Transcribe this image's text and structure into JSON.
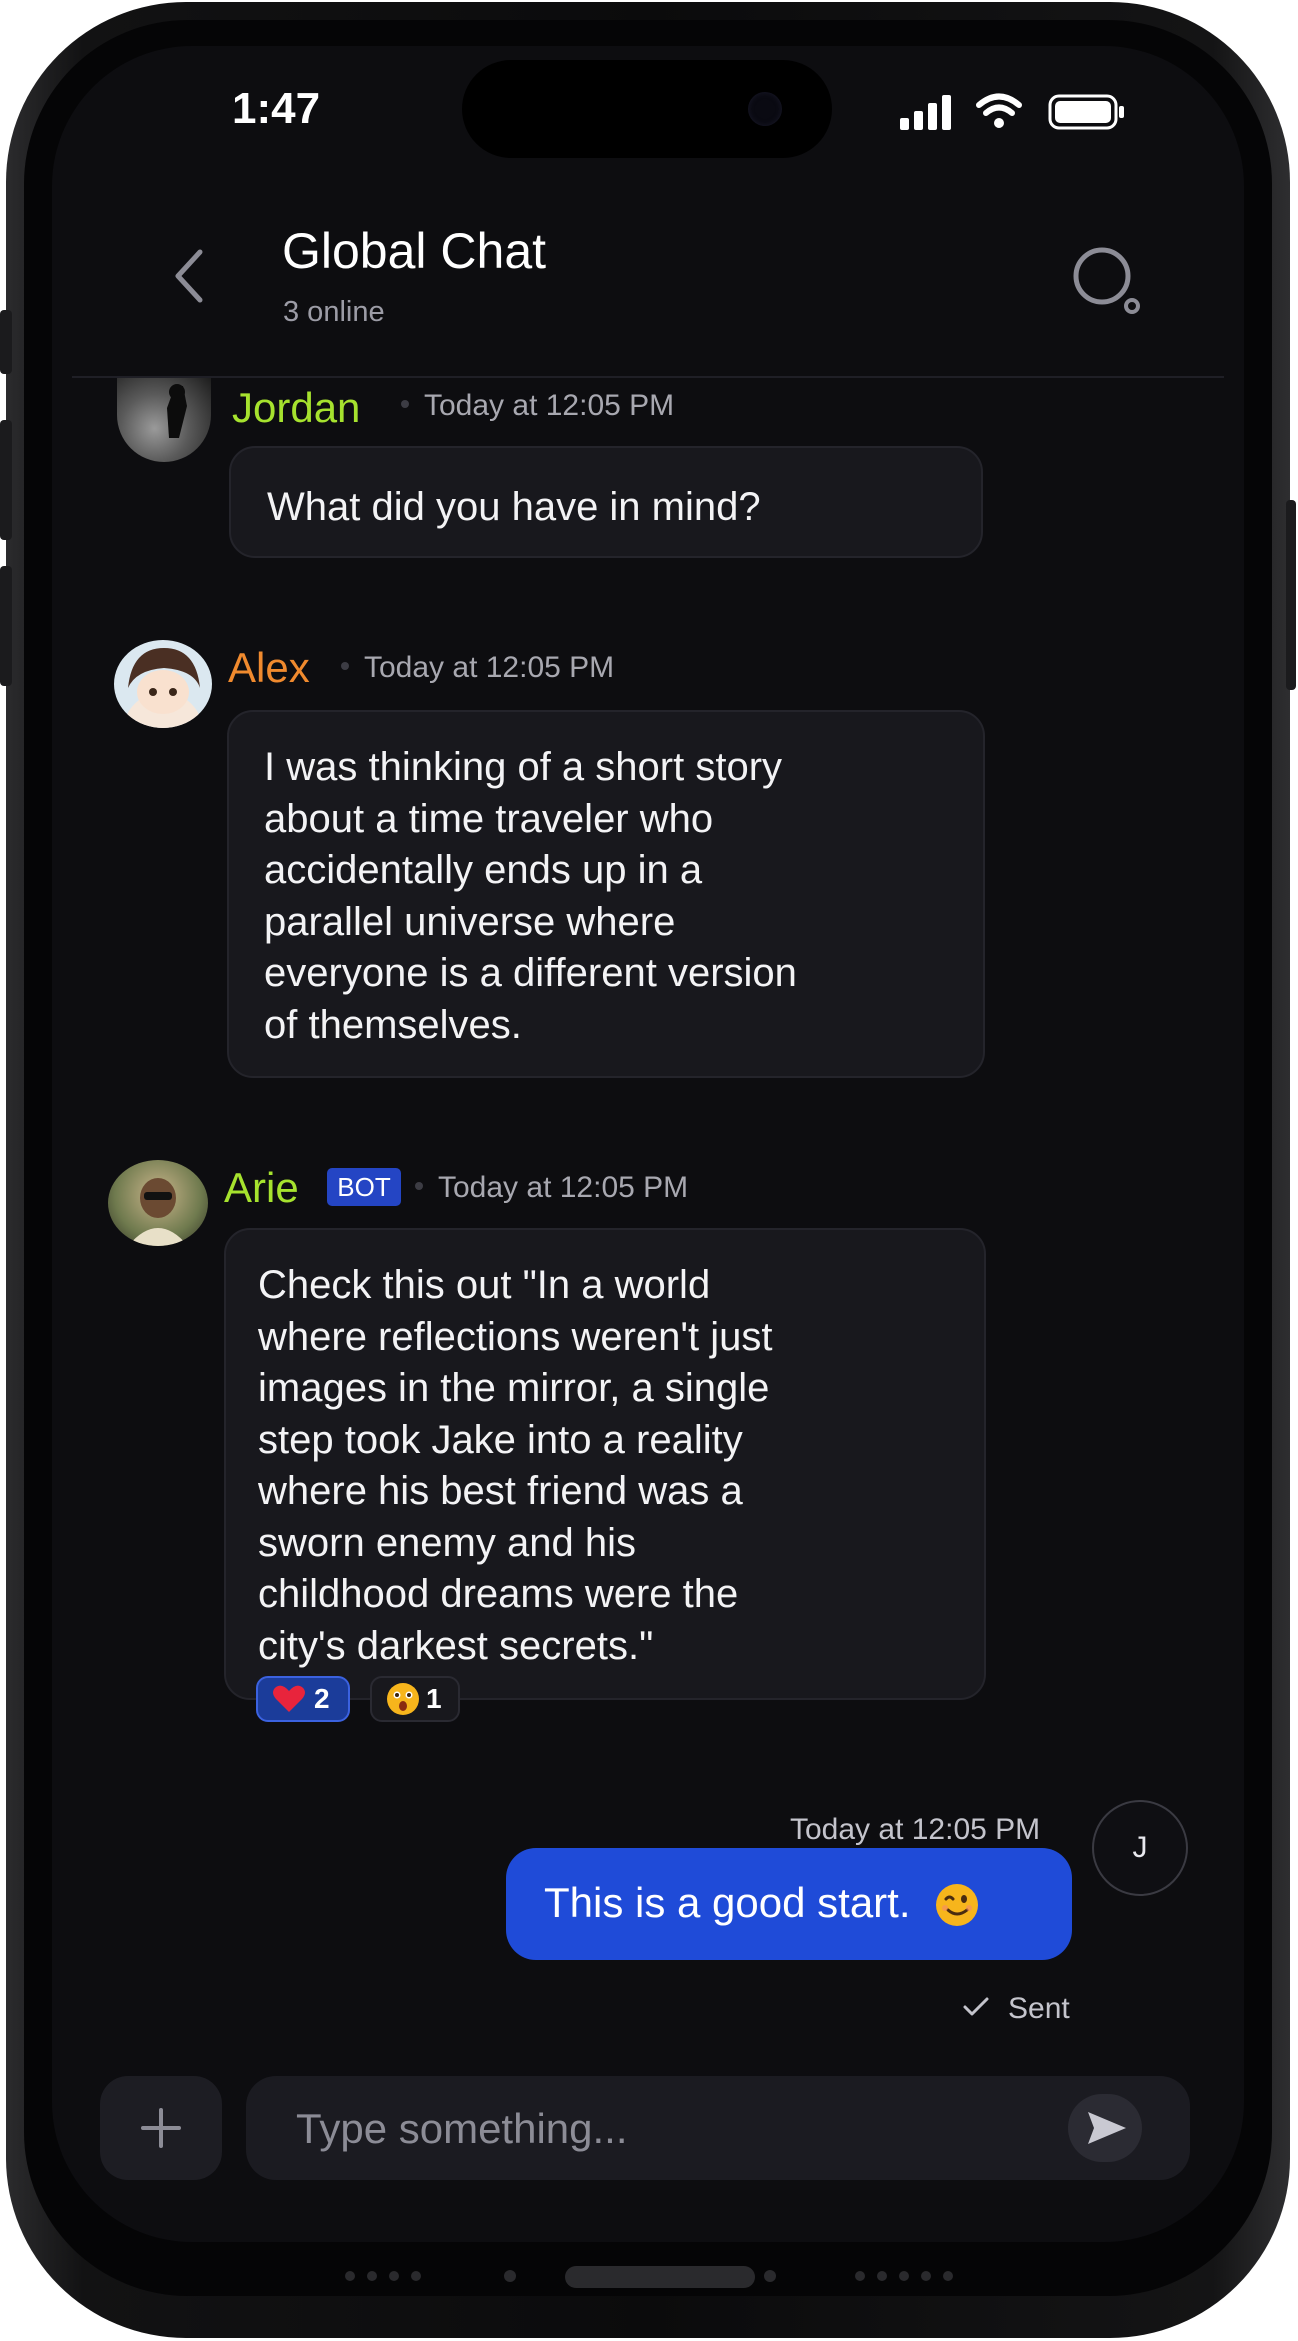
{
  "status_bar": {
    "time": "1:47"
  },
  "header": {
    "title": "Global Chat",
    "subtitle": "3 online"
  },
  "messages": [
    {
      "author": "Jordan",
      "name_color": "#a6e22e",
      "timestamp": "Today at 12:05 PM",
      "text": "What did you have in mind?"
    },
    {
      "author": "Alex",
      "name_color": "#f08a2e",
      "timestamp": "Today at 12:05 PM",
      "lines": [
        "I was thinking of a short story",
        "about a time traveler who",
        "accidentally ends up in a",
        "parallel universe where",
        "everyone is a different version",
        "of themselves."
      ]
    },
    {
      "author": "Arie",
      "name_color": "#a6e22e",
      "badge": "BOT",
      "timestamp": "Today at 12:05 PM",
      "lines": [
        "Check this out \"In a world",
        "where reflections weren't just",
        "images in the mirror, a single",
        "step took Jake into a reality",
        "where his best friend was a",
        "sworn enemy and his",
        "childhood dreams were the",
        "city's darkest secrets.\""
      ],
      "reactions": [
        {
          "emoji": "heart",
          "count": "2"
        },
        {
          "emoji": "astonished-face",
          "count": "1"
        }
      ]
    }
  ],
  "own_message": {
    "timestamp": "Today at 12:05 PM",
    "text": "This is a good start.",
    "emoji": "winking-face",
    "status": "Sent",
    "avatar_initial": "J"
  },
  "composer": {
    "placeholder": "Type something..."
  },
  "colors": {
    "accent": "#1f4bd8",
    "bot_badge": "#2445c4",
    "background": "#0d0d10"
  }
}
